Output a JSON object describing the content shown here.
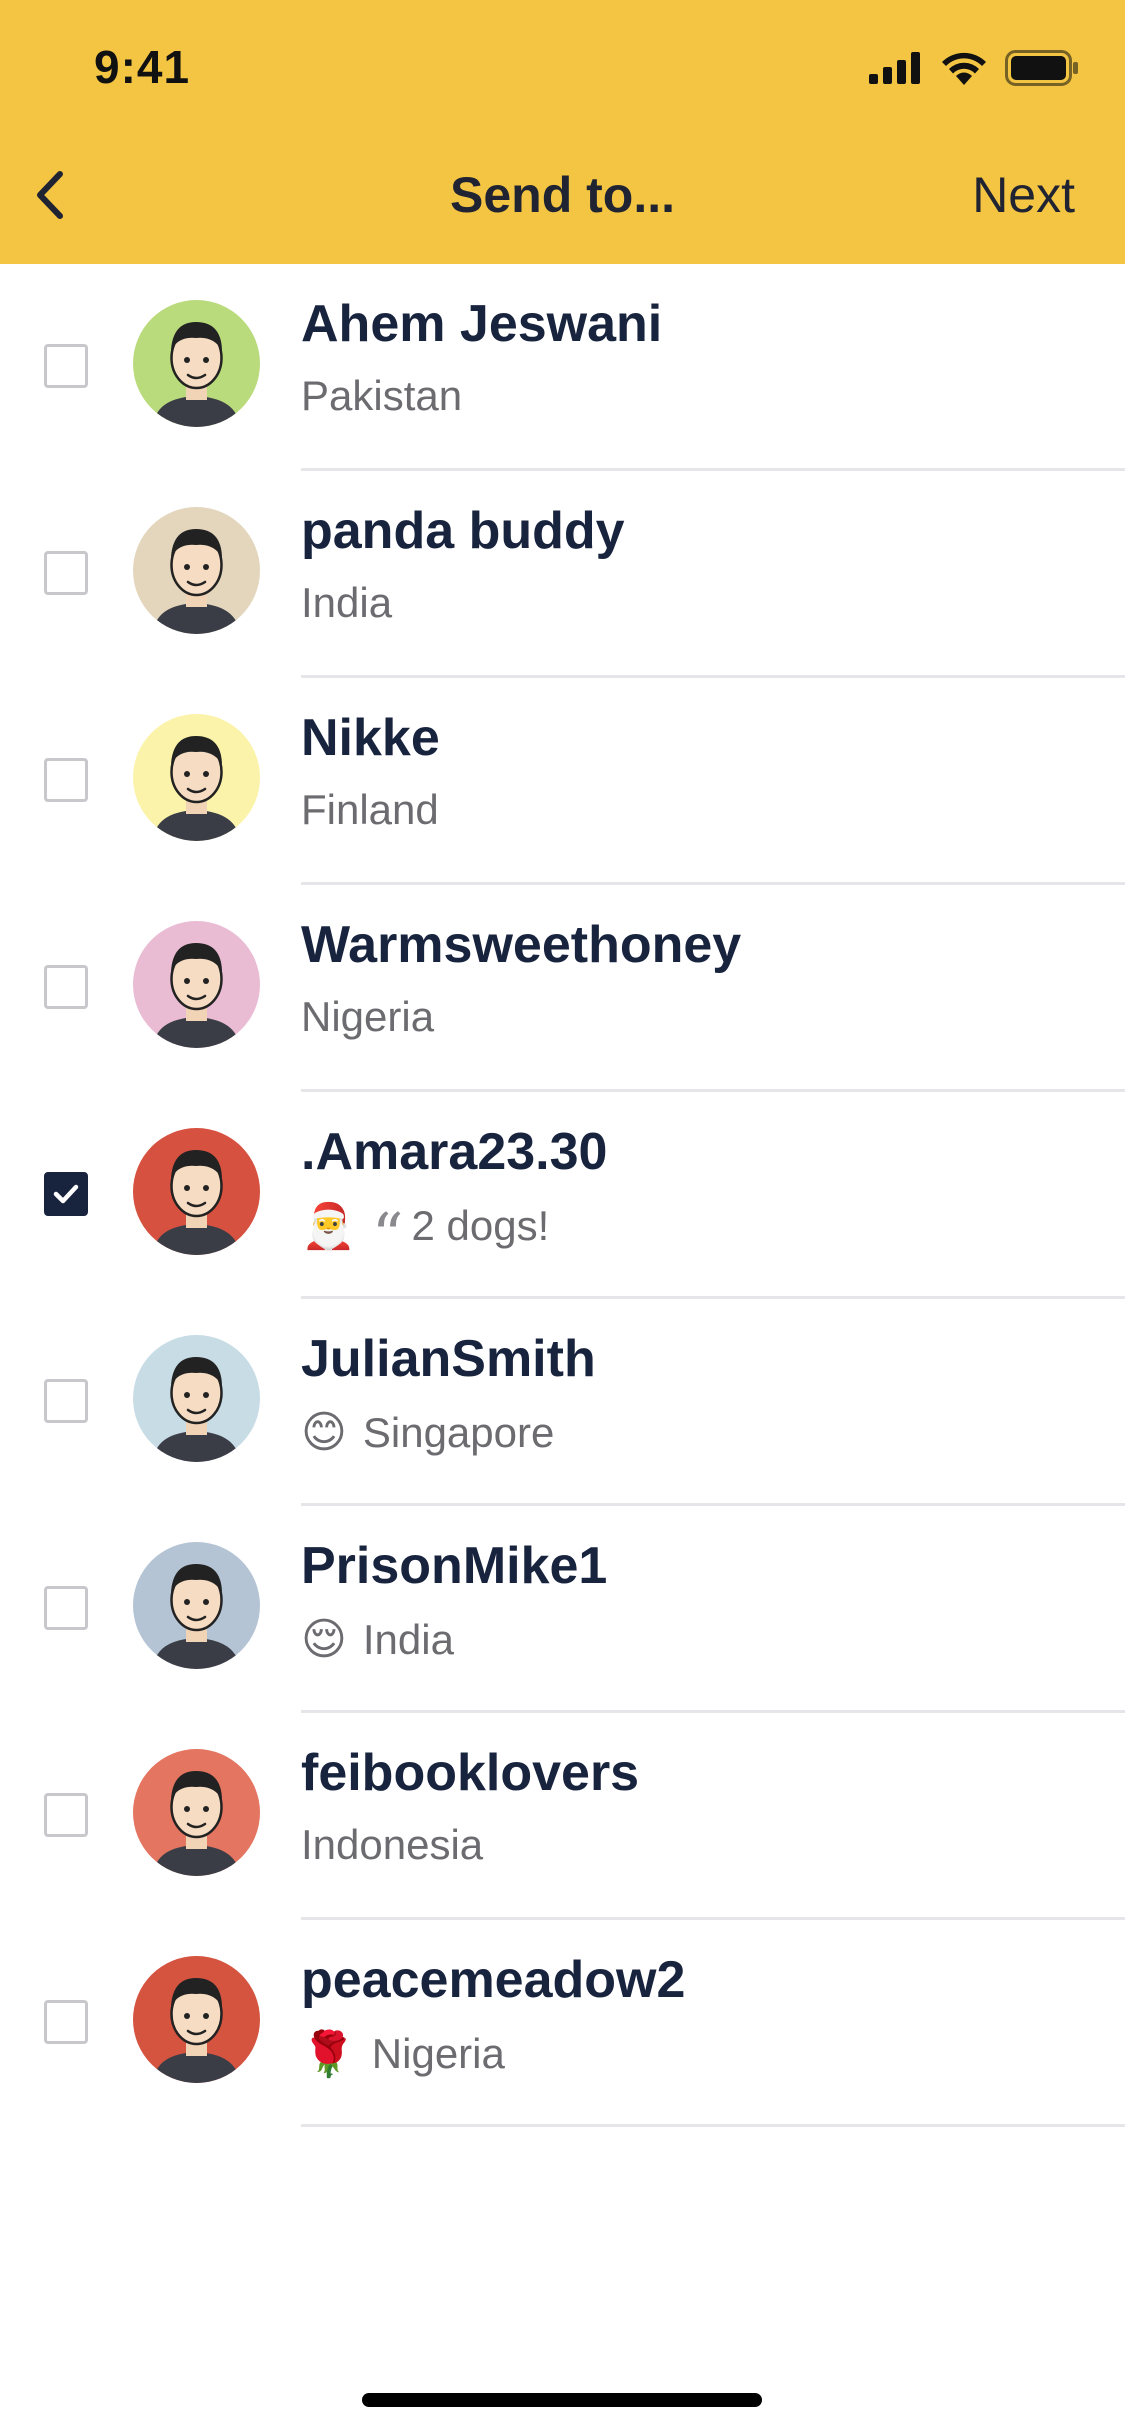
{
  "status_bar": {
    "time": "9:41"
  },
  "header": {
    "title": "Send to...",
    "next_label": "Next"
  },
  "contacts": [
    {
      "name": "Ahem Jeswani",
      "subtitle": "Pakistan",
      "emoji": "",
      "quote": false,
      "checked": false,
      "avatar_bg": "#B9DB7C"
    },
    {
      "name": "panda buddy",
      "subtitle": "India",
      "emoji": "",
      "quote": false,
      "checked": false,
      "avatar_bg": "#E3D6BD"
    },
    {
      "name": "Nikke",
      "subtitle": "Finland",
      "emoji": "",
      "quote": false,
      "checked": false,
      "avatar_bg": "#FBF3A9"
    },
    {
      "name": "Warmsweethoney",
      "subtitle": "Nigeria",
      "emoji": "",
      "quote": false,
      "checked": false,
      "avatar_bg": "#E9BCD4"
    },
    {
      "name": ".Amara23.30",
      "subtitle": "2 dogs!",
      "emoji": "🎅",
      "quote": true,
      "checked": true,
      "avatar_bg": "#D6513F"
    },
    {
      "name": "JulianSmith",
      "subtitle": "Singapore",
      "emoji": "😊",
      "quote": false,
      "checked": false,
      "avatar_bg": "#C8DCE6"
    },
    {
      "name": "PrisonMike1",
      "subtitle": "India",
      "emoji": "😌",
      "quote": false,
      "checked": false,
      "avatar_bg": "#B5C4D4"
    },
    {
      "name": "feibooklovers",
      "subtitle": "Indonesia",
      "emoji": "",
      "quote": false,
      "checked": false,
      "avatar_bg": "#E37561"
    },
    {
      "name": "peacemeadow2",
      "subtitle": "Nigeria",
      "emoji": "🌹",
      "quote": false,
      "checked": false,
      "avatar_bg": "#D45440"
    }
  ]
}
